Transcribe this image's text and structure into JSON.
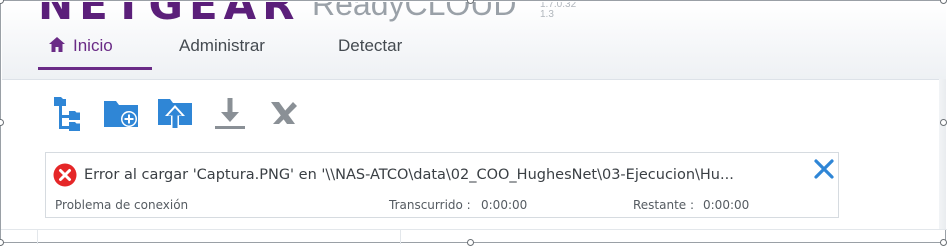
{
  "app": {
    "brand": "NETGEAR",
    "product": "ReadyCLOUD",
    "version_lines": [
      "1.7.0.32",
      "1.3"
    ]
  },
  "tabs": [
    {
      "label": "Inicio",
      "active": true,
      "icon": "home-icon"
    },
    {
      "label": "Administrar",
      "active": false
    },
    {
      "label": "Detectar",
      "active": false
    }
  ],
  "toolbar": {
    "items": [
      {
        "name": "folder-tree-icon"
      },
      {
        "name": "new-folder-icon"
      },
      {
        "name": "upload-icon"
      },
      {
        "name": "download-icon"
      },
      {
        "name": "cancel-tool-icon"
      }
    ]
  },
  "transfer": {
    "status_icon": "error-icon",
    "message": "Error al cargar 'Captura.PNG' en '\\\\NAS-ATCO\\data\\02_COO_HughesNet\\03-Ejecucion\\Hu...",
    "reason": "Problema de conexión",
    "elapsed_label": "Transcurrido :",
    "elapsed_value": "0:00:00",
    "remaining_label": "Restante :",
    "remaining_value": "0:00:00"
  },
  "colors": {
    "accent": "#6a2b86",
    "toolbar_blue": "#2f86d6",
    "error_red": "#e52728",
    "close_blue": "#2f86d6"
  }
}
